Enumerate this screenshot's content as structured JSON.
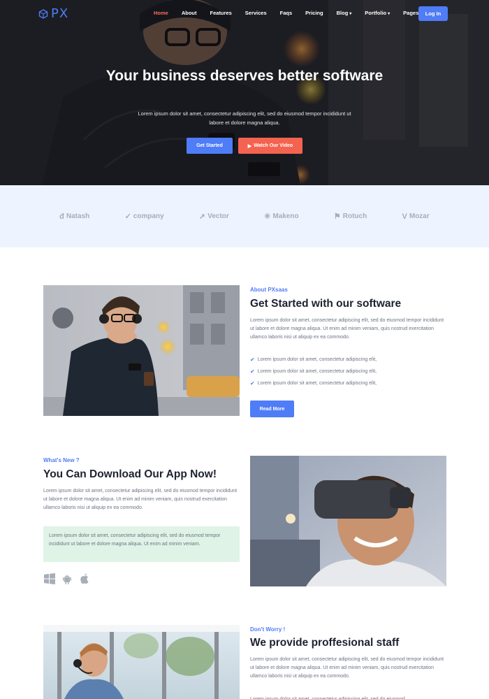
{
  "brand": {
    "name": "PX"
  },
  "nav": {
    "items": [
      {
        "label": "Home",
        "active": true
      },
      {
        "label": "About"
      },
      {
        "label": "Features"
      },
      {
        "label": "Services"
      },
      {
        "label": "Faqs"
      },
      {
        "label": "Pricing"
      },
      {
        "label": "Blog",
        "dropdown": true
      },
      {
        "label": "Portfolio",
        "dropdown": true
      },
      {
        "label": "Pages",
        "dropdown": true
      }
    ],
    "login_label": "Log In"
  },
  "hero": {
    "title": "Your business deserves better software",
    "subtitle": "Lorem ipsum dolor sit amet, consectetur adipiscing elit, sed do eiusmod tempor incididunt ut labore et dolore magna aliqua.",
    "cta_primary": "Get Started",
    "cta_video": "Watch Our Video"
  },
  "clients": [
    "Natash",
    "company",
    "Vector",
    "Makeno",
    "Rotuch",
    "Mozar"
  ],
  "about": {
    "eyebrow": "About PXsaas",
    "title": "Get Started with our software",
    "body": "Lorem ipsum dolor sit amet, consectetur adipiscing elit, sed do eiusmod tempor incididunt ut labore et dolore magna aliqua. Ut enim ad minim veniam, quis nostrud exercitation ullamco laboris nisi ut aliquip ex ea commodo.",
    "checks": [
      "Lorem ipsum dolor sit amet, consectetur adipiscing elit,",
      "Lorem ipsum dolor sit amet, consectetur adipiscing elit,",
      "Lorem ipsum dolor sit amet, consectetur adipiscing elit,"
    ],
    "button": "Read More"
  },
  "app": {
    "eyebrow": "What's New ?",
    "title": "You Can Download Our App Now!",
    "body": "Lorem ipsum dolor sit amet, consectetur adipiscing elit, sed do eiusmod tempor incididunt ut labore et dolore magna aliqua. Ut enim ad minim veniam, quis nostrud exercitation ullamco laboris nisi ut aliquip ex ea commodo.",
    "note": "Lorem ipsum dolor sit amet, consectetur adipiscing elit, sed do eiusmod tempor incididunt ut labore et dolore magna aliqua. Ut enim ad minim veniam.",
    "platforms": [
      "windows-icon",
      "android-icon",
      "apple-icon"
    ]
  },
  "staff": {
    "eyebrow": "Don't Worry !",
    "title": "We provide proffesional staff",
    "body": "Lorem ipsum dolor sit amet, consectetur adipiscing elit, sed do eiusmod tempor incididunt ut labore et dolore magna aliqua. Ut enim ad minim veniam, quis nostrud exercitation ullamco laboris nisi ut aliquip ex ea commodo.",
    "body2": "Lorem ipsum dolor sit amet, consectetur adipiscing elit, sed do eiusmod"
  },
  "colors": {
    "accent": "#4f7cf7",
    "coral": "#f4634f",
    "clients_bg": "#eef4ff",
    "note_bg": "#dff3e6"
  }
}
